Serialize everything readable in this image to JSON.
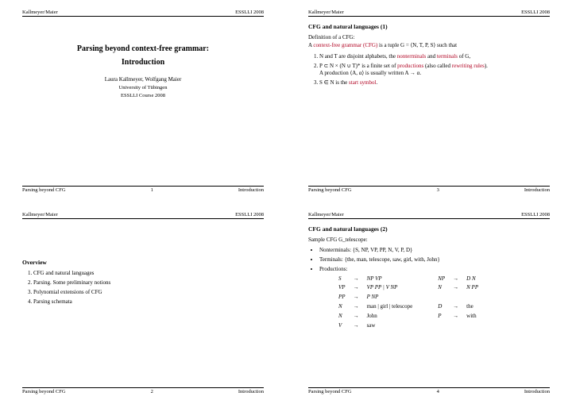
{
  "header": {
    "left": "Kallmeyer/Maier",
    "right": "ESSLLI 2008"
  },
  "footer": {
    "left": "Parsing beyond CFG",
    "right": "Introduction"
  },
  "slide1": {
    "pagenum": "1",
    "title": "Parsing beyond context-free grammar:",
    "subtitle": "Introduction",
    "authors": "Laura Kallmeyer, Wolfgang Maier",
    "uni": "University of Tübingen",
    "course": "ESSLLI Course 2008"
  },
  "slide2": {
    "pagenum": "2",
    "heading": "Overview",
    "items": {
      "i1": "CFG and natural languages",
      "i2": "Parsing. Some preliminary notions",
      "i3": "Polynomial extensions of CFG",
      "i4": "Parsing schemata"
    }
  },
  "slide3": {
    "pagenum": "3",
    "heading": "CFG and natural languages (1)",
    "def": "Definition of a CFG:",
    "line1a": "A ",
    "line1link": "context-free grammar (CFG)",
    "line1b": " is a tuple G = ⟨N, T, P, S⟩ such that",
    "li1a": "N and T are disjoint alphabets, the ",
    "li1link1": "nonterminals",
    "li1b": " and ",
    "li1link2": "terminals",
    "li1c": " of G,",
    "li2a": "P ⊂ N × (N ∪ T)* is a finite set of ",
    "li2link": "productions",
    "li2b": " (also called ",
    "li2link2": "rewriting rules",
    "li2c": ").",
    "li2note": "A production ⟨A, α⟩ is usually written A → α.",
    "li3a": "S ∈ N is the ",
    "li3link": "start symbol",
    "li3b": "."
  },
  "slide4": {
    "pagenum": "4",
    "heading": "CFG and natural languages (2)",
    "sample": "Sample CFG G_telescope:",
    "nt": "Nonterminals: {S, NP, VP, PP, N, V, P, D}",
    "t": "Terminals: {the, man, telescope, saw, girl, with, John}",
    "prodlabel": "Productions:",
    "prods": {
      "r1l": "S",
      "r1a": "→",
      "r1r": "NP VP",
      "r1l2": "NP",
      "r1a2": "→",
      "r1r2": "D N",
      "r2l": "VP",
      "r2a": "→",
      "r2r": "VP PP | V NP",
      "r2l2": "N",
      "r2a2": "→",
      "r2r2": "N PP",
      "r3l": "PP",
      "r3a": "→",
      "r3r": "P NP",
      "r4l": "N",
      "r4a": "→",
      "r4r": "man | girl | telescope",
      "r4l2": "D",
      "r4a2": "→",
      "r4r2": "the",
      "r5l": "N",
      "r5a": "→",
      "r5r": "John",
      "r5l2": "P",
      "r5a2": "→",
      "r5r2": "with",
      "r6l": "V",
      "r6a": "→",
      "r6r": "saw"
    }
  }
}
